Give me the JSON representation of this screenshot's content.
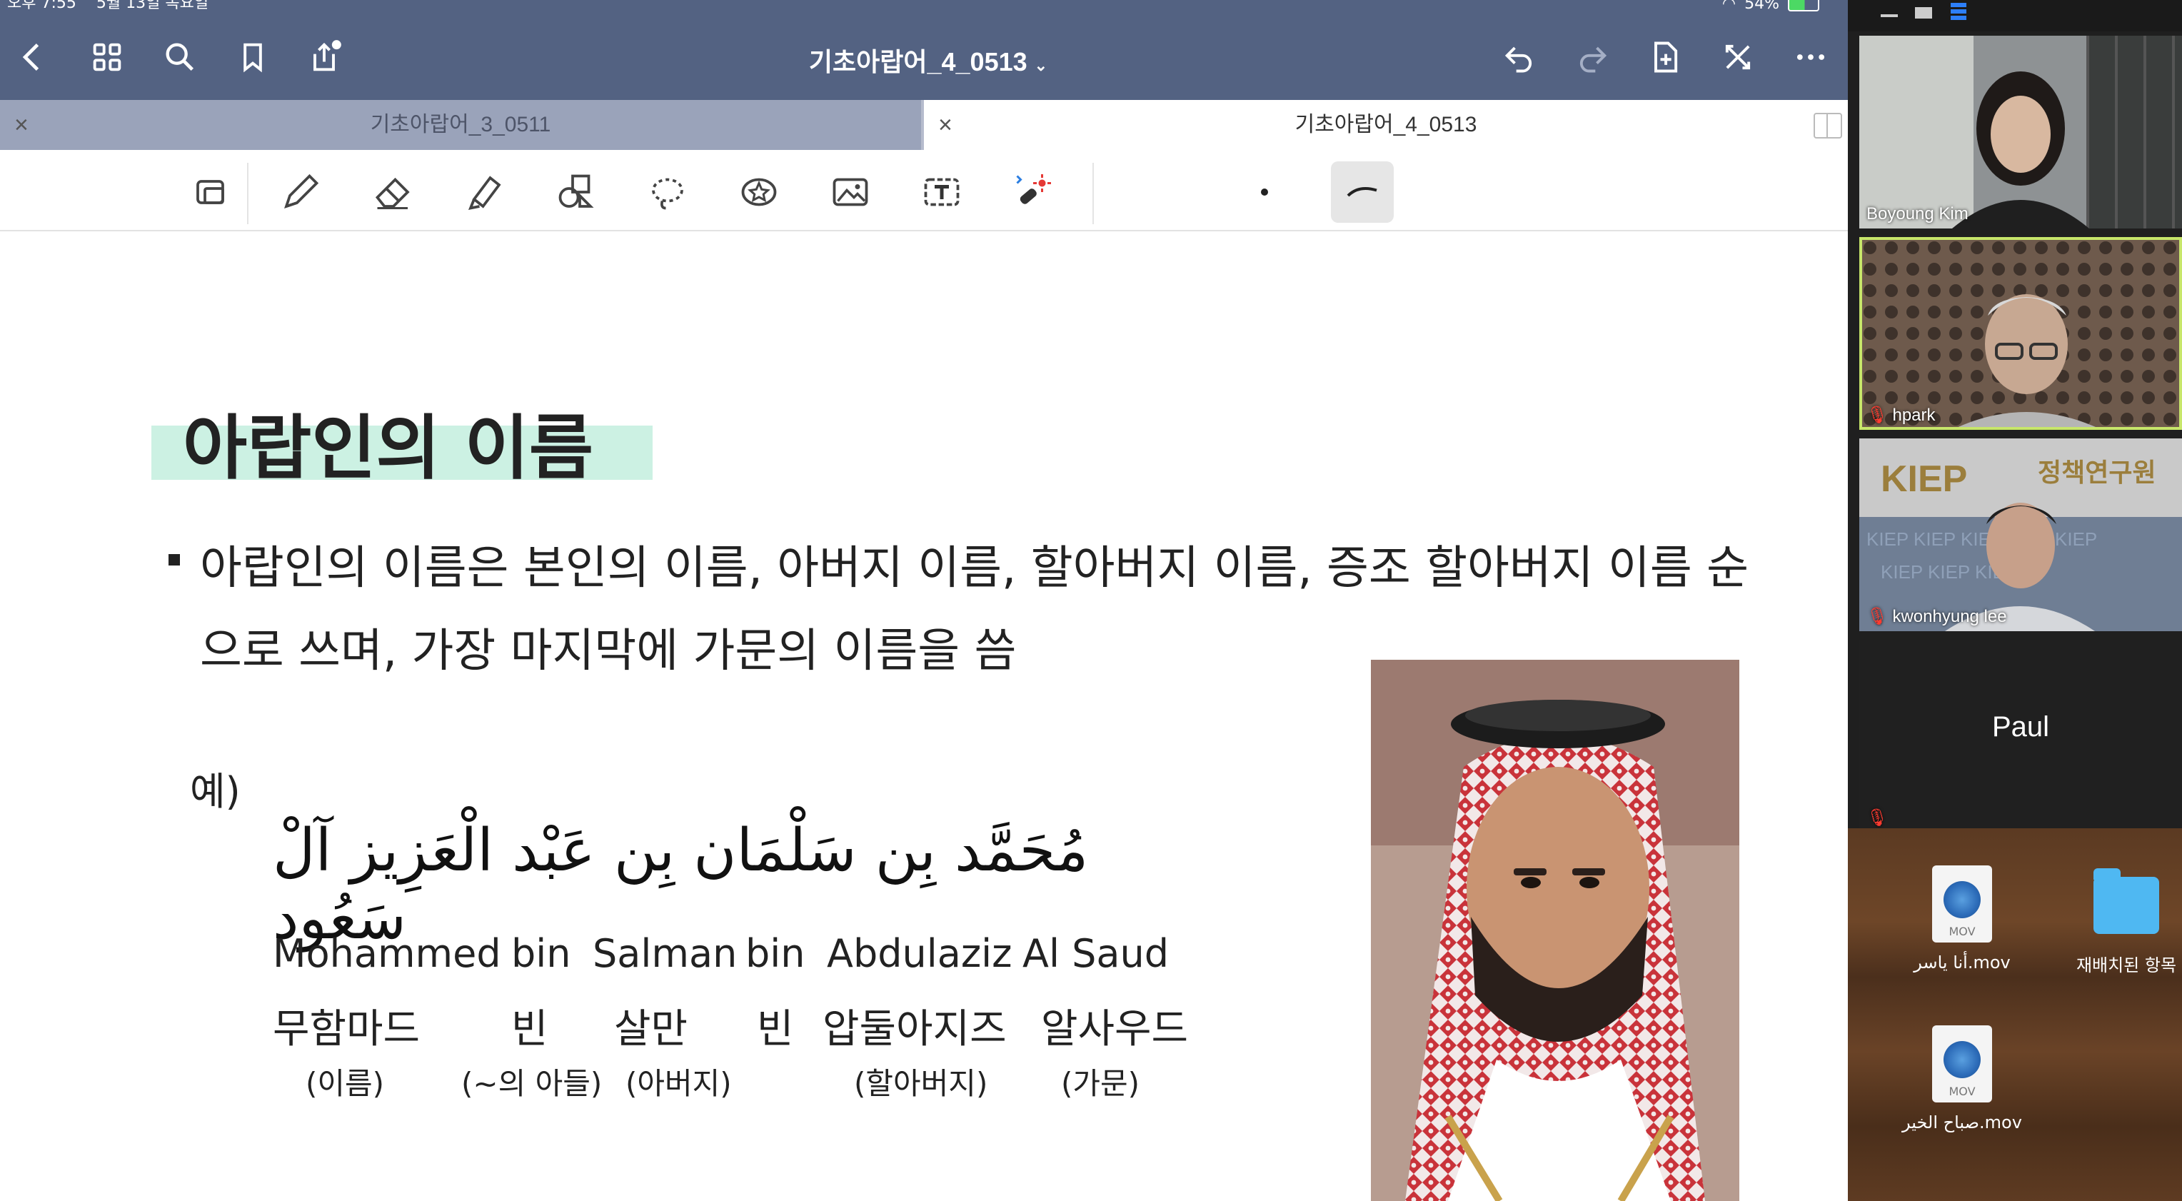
{
  "status": {
    "time": "오후 7:55",
    "date": "5월 13일 목요일",
    "battery": "54%"
  },
  "document": {
    "title": "기초아랍어_4_0513"
  },
  "tabs": [
    {
      "label": "기초아랍어_3_0511",
      "active": false
    },
    {
      "label": "기초아랍어_4_0513",
      "active": true
    }
  ],
  "slide": {
    "heading": "아랍인의 이름",
    "paragraph": "아랍인의 이름은 본인의 이름, 아버지 이름, 할아버지 이름, 증조 할아버지 이름 순으로 쓰며, 가장 마지막에 가문의 이름을 씀",
    "example_label": "예)",
    "arabic": "مُحَمَّد بِن سَلْمَان بِن عَبْد الْعَزِيز آلْ سَعُود",
    "roman": [
      "Mohammed",
      "bin",
      "Salman",
      "bin",
      "Abdulaziz",
      "Al Saud"
    ],
    "korean": [
      "무함마드",
      "빈",
      "살만",
      "빈",
      "압둘아지즈",
      "알사우드"
    ],
    "gloss": [
      "(이름)",
      "(~의 아들)",
      "(아버지)",
      "(할아버지)",
      "(가문)"
    ]
  },
  "participants": [
    {
      "name": "Boyoung Kim",
      "muted": false,
      "active": false
    },
    {
      "name": "hpark",
      "muted": true,
      "active": true
    },
    {
      "name": "kwonhyung lee",
      "muted": true,
      "active": false
    },
    {
      "name": "Paul",
      "muted": true,
      "active": false
    }
  ],
  "desktop_files": [
    {
      "name": "أنا ياسر.mov",
      "ext": "MOV"
    },
    {
      "name": "재배치된 항목",
      "ext": ""
    },
    {
      "name": "صباح الخير.mov",
      "ext": "MOV"
    }
  ]
}
